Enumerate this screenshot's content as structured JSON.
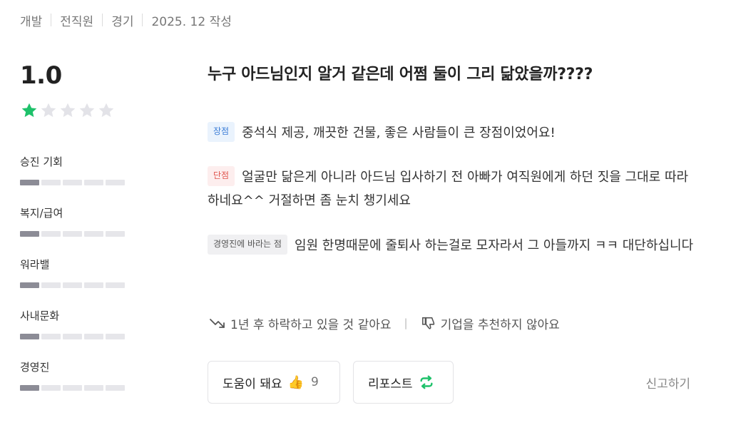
{
  "meta": {
    "job": "개발",
    "status": "전직원",
    "region": "경기",
    "date": "2025. 12 작성"
  },
  "rating": {
    "score": "1.0",
    "stars_filled": 1,
    "stars_total": 5,
    "star_color": "#1ec16a",
    "star_empty_color": "#e3e3e8"
  },
  "categories": [
    {
      "label": "승진 기회",
      "value": 1,
      "max": 5
    },
    {
      "label": "복지/급여",
      "value": 1,
      "max": 5
    },
    {
      "label": "워라밸",
      "value": 1,
      "max": 5
    },
    {
      "label": "사내문화",
      "value": 1,
      "max": 5
    },
    {
      "label": "경영진",
      "value": 1,
      "max": 5
    }
  ],
  "review": {
    "title": "누구 아드님인지 알거 같은데 어쩜 둘이 그리 닮았을까????",
    "pros_tag": "장점",
    "pros": "중석식 제공, 깨끗한 건물, 좋은 사람들이 큰 장점이었어요!",
    "cons_tag": "단점",
    "cons": "얼굴만 닮은게 아니라 아드님 입사하기 전 아빠가 여직원에게 하던 짓을 그대로 따라하네요^^ 거절하면 좀 눈치 챙기세요",
    "msg_tag": "경영진에 바라는 점",
    "msg": "임원 한명때문에 줄퇴사 하는걸로 모자라서 그 아들까지 ㅋㅋ 대단하십니다"
  },
  "outlook": {
    "trend_icon": "trend-down-icon",
    "trend": "1년 후 하락하고 있을 것 같아요",
    "divider": "|",
    "recommend_icon": "thumbs-down-icon",
    "recommend": "기업을 추천하지 않아요"
  },
  "actions": {
    "helpful_label": "도움이 돼요",
    "helpful_icon": "👍",
    "helpful_count": "9",
    "repost_label": "리포스트",
    "repost_icon_color": "#1ec16a",
    "report_label": "신고하기"
  }
}
